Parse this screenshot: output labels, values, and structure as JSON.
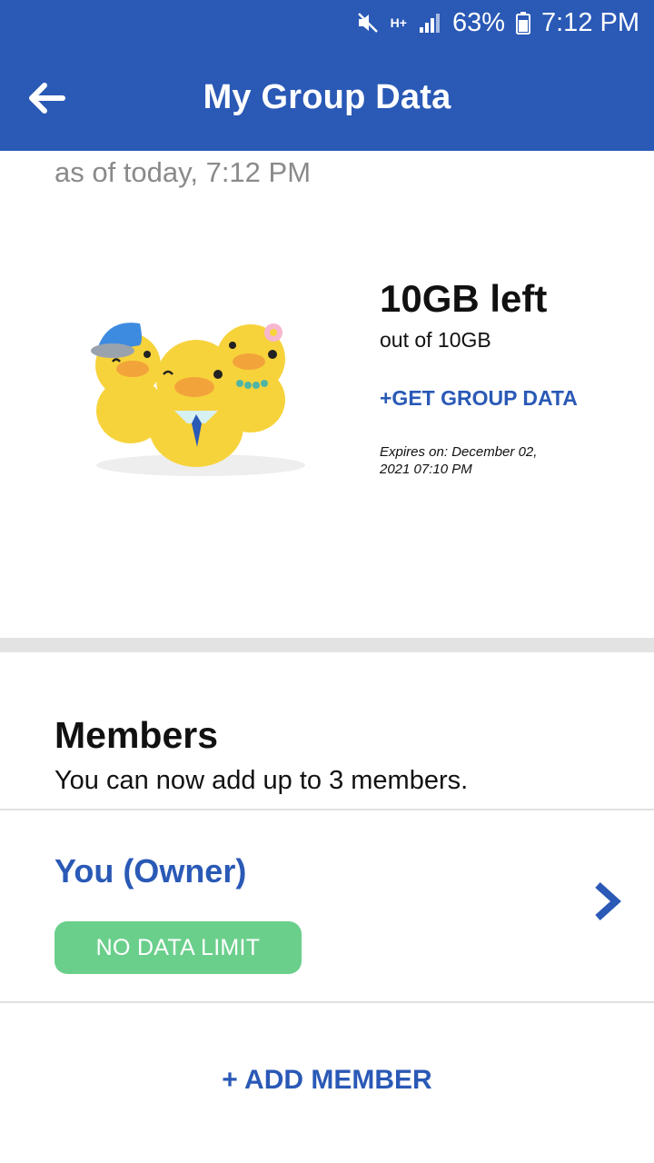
{
  "status_bar": {
    "network": "H+",
    "battery_percent": "63%",
    "time": "7:12 PM",
    "icons": [
      "mute-icon",
      "network-type-icon",
      "signal-icon",
      "battery-icon"
    ]
  },
  "app_bar": {
    "title": "My Group Data",
    "back_icon": "back-arrow-icon",
    "background_color": "#2a59b6"
  },
  "usage": {
    "as_of": "as of today, 7:12 PM",
    "remaining": "10GB left",
    "total": "out of 10GB",
    "get_data_label": "+GET GROUP DATA",
    "expires": "Expires on: December 02, 2021 07:10 PM",
    "illustration": "three-ducks-illustration"
  },
  "members": {
    "title": "Members",
    "subtitle": "You can now add up to 3 members.",
    "list": [
      {
        "name": "You (Owner)",
        "badge": "NO DATA LIMIT",
        "badge_color": "#6bcf8c",
        "chevron_icon": "chevron-right-icon"
      }
    ],
    "add_label": "+ ADD MEMBER"
  },
  "colors": {
    "primary": "#2a59b6",
    "accent_green": "#6bcf8c",
    "muted_text": "#8a8a8a"
  }
}
